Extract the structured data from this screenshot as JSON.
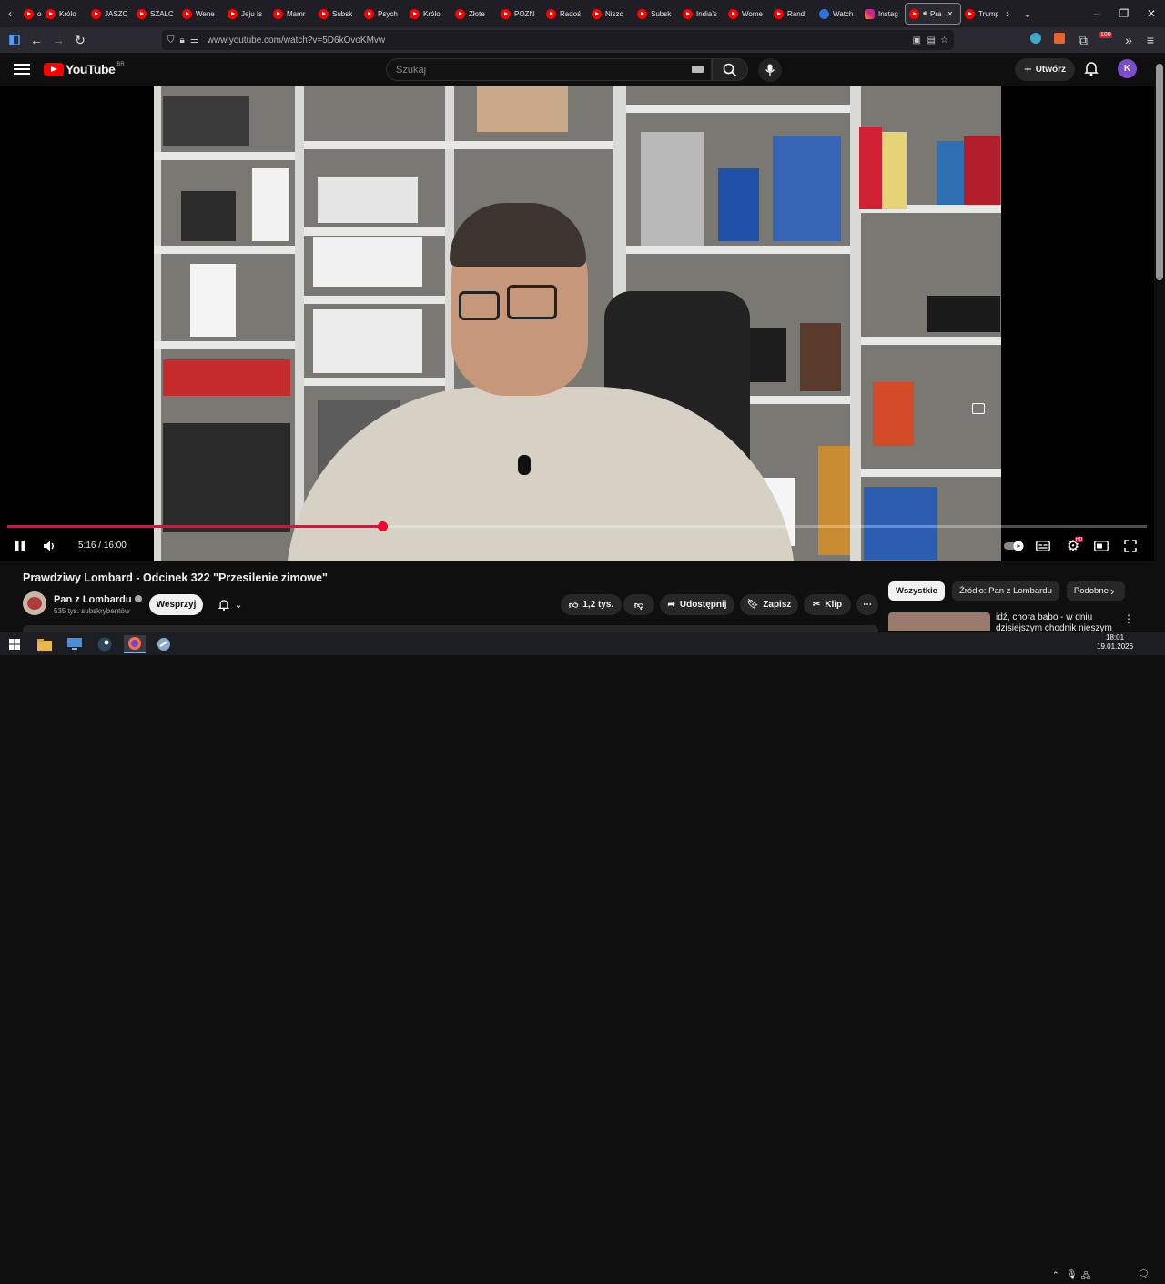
{
  "browser": {
    "tabs": [
      {
        "label": "ocl",
        "icon": "youtube"
      },
      {
        "label": "Królo",
        "icon": "youtube"
      },
      {
        "label": "JASZC",
        "icon": "youtube"
      },
      {
        "label": "SZALC",
        "icon": "youtube"
      },
      {
        "label": "Wene",
        "icon": "youtube"
      },
      {
        "label": "Jeju Is",
        "icon": "youtube"
      },
      {
        "label": "Mamr",
        "icon": "youtube"
      },
      {
        "label": "Subsk",
        "icon": "youtube"
      },
      {
        "label": "Psych",
        "icon": "youtube"
      },
      {
        "label": "Królo",
        "icon": "youtube"
      },
      {
        "label": "Złote",
        "icon": "youtube"
      },
      {
        "label": "POZN",
        "icon": "youtube"
      },
      {
        "label": "Radoś",
        "icon": "youtube"
      },
      {
        "label": "Niszc",
        "icon": "youtube"
      },
      {
        "label": "Subsk",
        "icon": "youtube"
      },
      {
        "label": "India's",
        "icon": "youtube"
      },
      {
        "label": "Wome",
        "icon": "youtube"
      },
      {
        "label": "Rand",
        "icon": "youtube"
      },
      {
        "label": "Watch",
        "icon": "whatsapp"
      },
      {
        "label": "Instag",
        "icon": "instagram"
      },
      {
        "label": "Pra",
        "icon": "youtube",
        "active": true
      },
      {
        "label": "Trump",
        "icon": "youtube"
      }
    ],
    "url": "www.youtube.com/watch?v=5D6kOvoKMvw",
    "extension_badge": "100"
  },
  "youtube": {
    "country_code": "BR",
    "logo_text": "YouTube",
    "search_placeholder": "Szukaj",
    "create_label": "Utwórz",
    "avatar_letter": "K"
  },
  "player": {
    "current_time": "5:16",
    "separator": "/",
    "duration": "16:00",
    "progress_fraction": 0.329,
    "settings_badge": "HD"
  },
  "video": {
    "title": "Prawdziwy Lombard - Odcinek 322 \"Przesilenie zimowe\"",
    "channel_name": "Pan z Lombardu",
    "subscribers": "535 tys. subskrybentów",
    "support_label": "Wesprzyj",
    "likes": "1,2 tys.",
    "share_label": "Udostępnij",
    "save_label": "Zapisz",
    "clip_label": "Klip"
  },
  "sidebar": {
    "chips": [
      "Wszystkie",
      "Źródło: Pan z Lombardu",
      "Podobne"
    ],
    "rec_title": "idź, chora babo - w dniu dzisiejszym chodnik nieszym"
  },
  "taskbar": {
    "time": "18:01",
    "date": "19.01.2026"
  },
  "colors": {
    "accent_red": "#ff0033",
    "avatar_purple": "#7c4dcb"
  }
}
